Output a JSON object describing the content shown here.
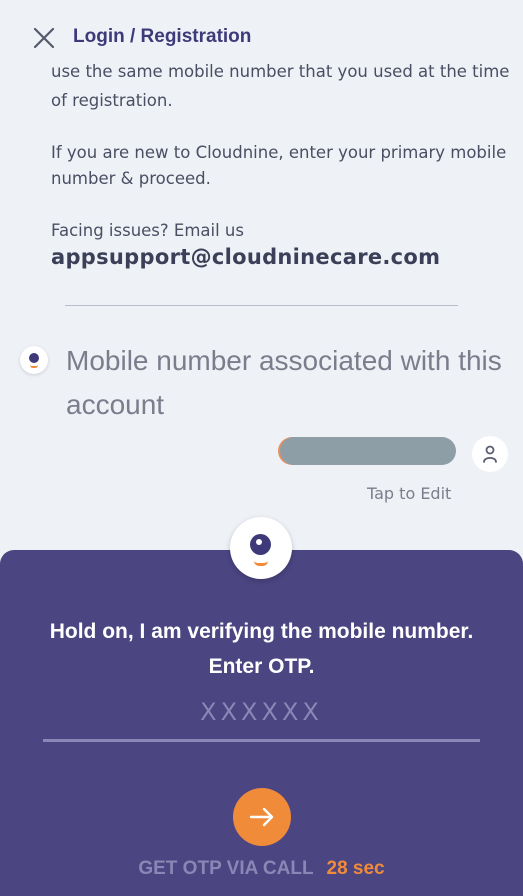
{
  "header": {
    "title": "Login / Registration",
    "close_icon": "close-icon"
  },
  "info": {
    "partial_line_1": "use the same mobile number that you used at the time",
    "partial_line_2": "of registration.",
    "new_user_text": "If you are new to Cloudnine, enter your primary mobile number & proceed.",
    "facing_issues": "Facing issues? Email us",
    "email": "appsupport@cloudninecare.com"
  },
  "chat": {
    "prompt": "Mobile number associated with this account",
    "tap_to_edit": "Tap to Edit",
    "user_icon": "user-icon"
  },
  "sheet": {
    "message_line_1": "Hold on, I am verifying the mobile number.",
    "message_line_2": "Enter OTP.",
    "otp_placeholder": "XXXXXX",
    "otp_value": "",
    "submit_icon": "arrow-right-icon",
    "call_label": "GET OTP VIA CALL",
    "timer": "28 sec"
  },
  "colors": {
    "accent": "#f08b3a",
    "sheet_bg": "#4b4582",
    "title": "#3e3a7a"
  }
}
